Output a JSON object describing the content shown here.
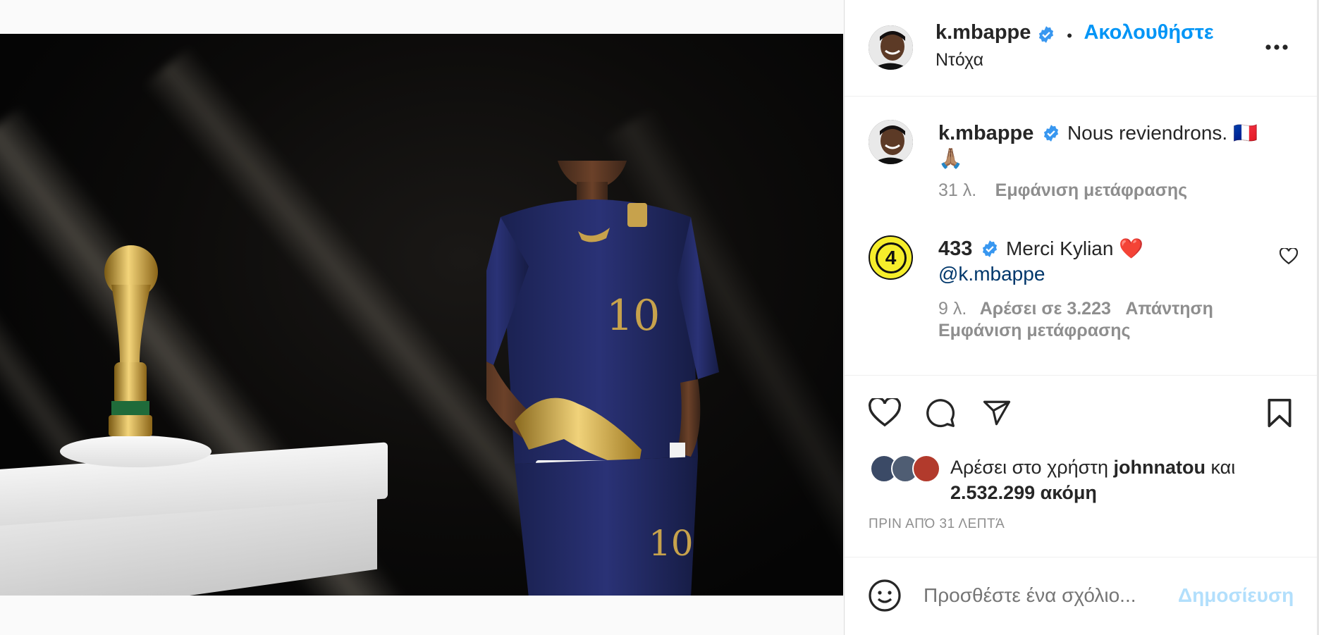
{
  "post_header": {
    "username": "k.mbappe",
    "dot": "•",
    "follow_label": "Ακολουθήστε",
    "subtitle": "Ντόχα",
    "more_icon": "more-horizontal-icon"
  },
  "caption": {
    "username": "k.mbappe",
    "text": "Nous reviendrons. 🇫🇷",
    "emoji_line": "🙏🏽",
    "time": "31 λ.",
    "translate": "Εμφάνιση μετάφρασης"
  },
  "comments": [
    {
      "username": "433",
      "text": "Merci Kylian ❤️",
      "mention": "@k.mbappe",
      "time": "9 λ.",
      "likes": "Αρέσει σε 3.223",
      "reply": "Απάντηση",
      "translate": "Εμφάνιση μετάφρασης",
      "avatar_label": "4"
    }
  ],
  "actions": {
    "like_icon": "heart-icon",
    "comment_icon": "comment-icon",
    "share_icon": "send-icon",
    "save_icon": "bookmark-icon"
  },
  "likes_line": {
    "prefix": "Αρέσει στο χρήστη ",
    "user": "johnnatou",
    "middle": " και",
    "count": "2.532.299 ακόμη"
  },
  "timestamp": "ΠΡΙΝ ΑΠΌ 31 ΛΕΠΤΆ",
  "comment_box": {
    "placeholder": "Προσθέστε ένα σχόλιο...",
    "post_label": "Δημοσίευση",
    "emoji_icon": "smiley-icon"
  },
  "colors": {
    "link": "#0095f6",
    "mention": "#00376b",
    "verified": "#3897f0",
    "muted": "#8e8e8e",
    "post_disabled": "#b2dffc"
  }
}
